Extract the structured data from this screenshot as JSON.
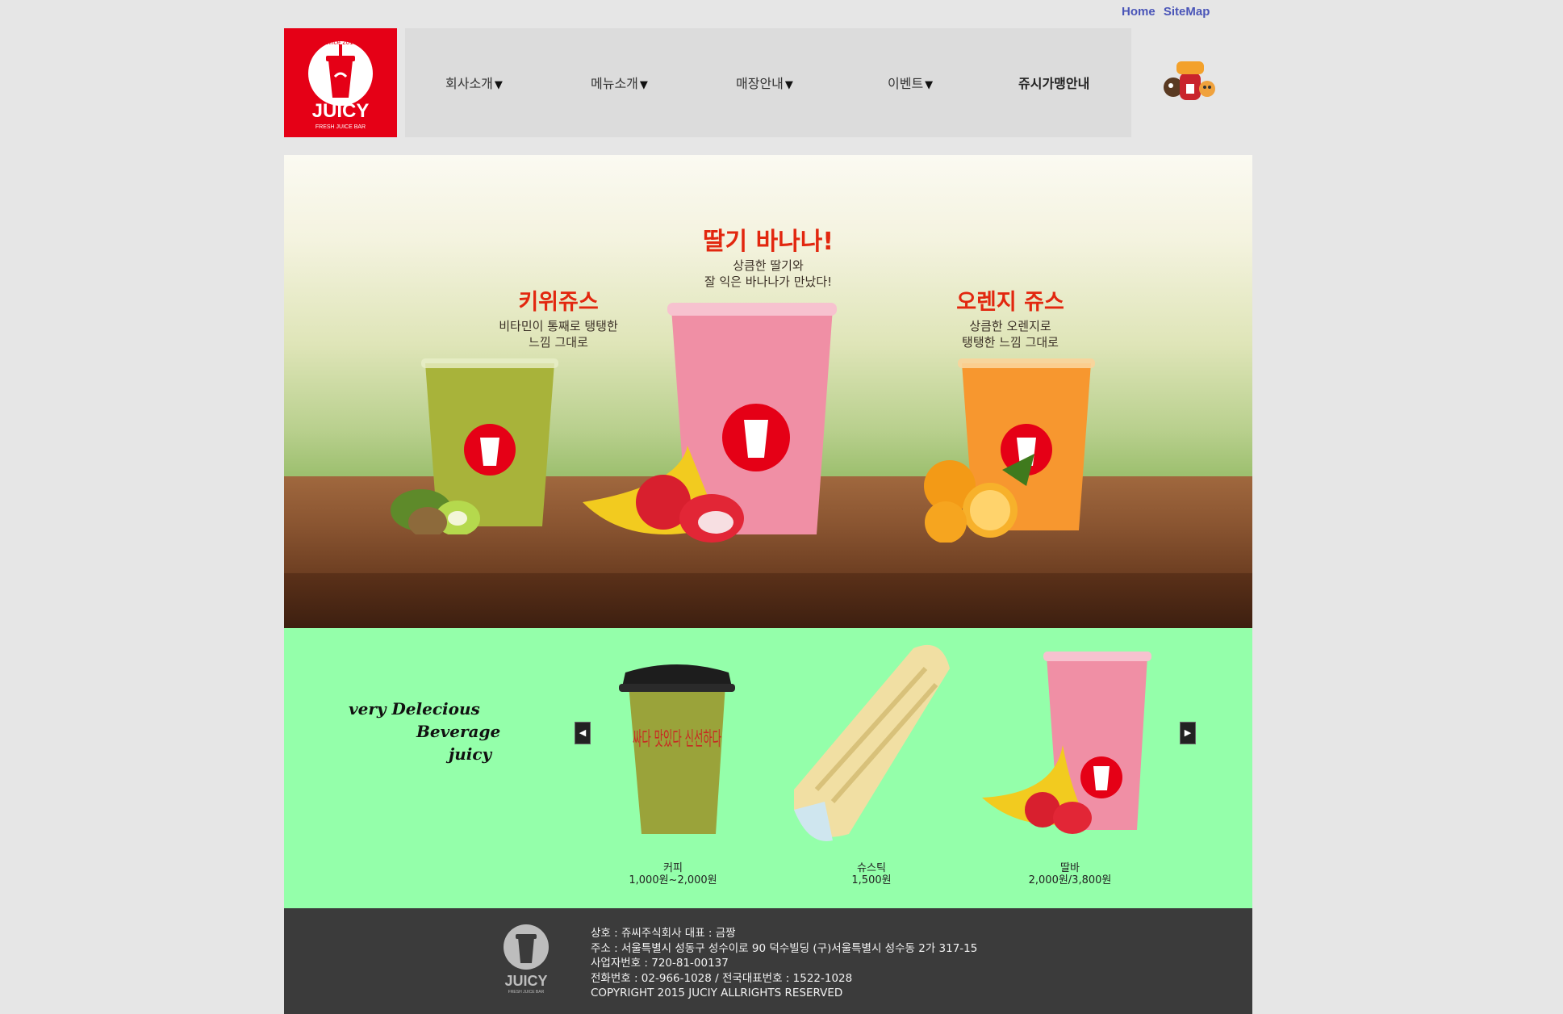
{
  "top_links": {
    "home": "Home",
    "sitemap": "SiteMap"
  },
  "brand": {
    "name": "JUICY",
    "tagline": "FRESH JUICE BAR",
    "since": "Since 2010"
  },
  "nav": [
    {
      "label": "회사소개",
      "caret": "▼"
    },
    {
      "label": "메뉴소개",
      "caret": "▼"
    },
    {
      "label": "매장안내",
      "caret": "▼"
    },
    {
      "label": "이벤트",
      "caret": "▼"
    },
    {
      "label": "쥬시가맹안내"
    }
  ],
  "hero": {
    "kiwi": {
      "title": "키위쥬스",
      "subtitle": "비타민이 통째로 탱탱한\n느낌 그대로"
    },
    "strawberry": {
      "title": "딸기 바나나!",
      "subtitle": "상큼한 딸기와\n잘 익은 바나나가 만났다!"
    },
    "orange": {
      "title": "오렌지 쥬스",
      "subtitle": "상큼한 오렌지로\n탱탱한 느낌 그대로"
    }
  },
  "slogan": [
    "very Delecious",
    "Beverage",
    "juicy"
  ],
  "coffee_cup_text": "싸다 맛있다 신선하다",
  "products": [
    {
      "name": "커피",
      "price": "1,000원~2,000원"
    },
    {
      "name": "슈스틱",
      "price": "1,500원"
    },
    {
      "name": "딸바",
      "price": "2,000원/3,800원"
    }
  ],
  "footer": {
    "lines": [
      "상호 : 쥬씨주식회사 대표 : 금짱",
      "주소 : 서울특별시 성동구 성수이로 90 덕수빌딩 (구)서울특별시 성수동 2가 317-15",
      "사업자번호 : 720-81-00137",
      "전화번호 : 02-966-1028 / 전국대표번호 : 1522-1028",
      "COPYRIGHT 2015 JUCIY ALLRIGHTS RESERVED"
    ]
  },
  "colors": {
    "brand_red": "#e50016",
    "strip_green": "#94ffaa",
    "footer_bg": "#3b3b3b",
    "link_blue": "#4a55b8"
  },
  "icons": [
    "prev-arrow-icon",
    "next-arrow-icon",
    "mascots-icon"
  ]
}
